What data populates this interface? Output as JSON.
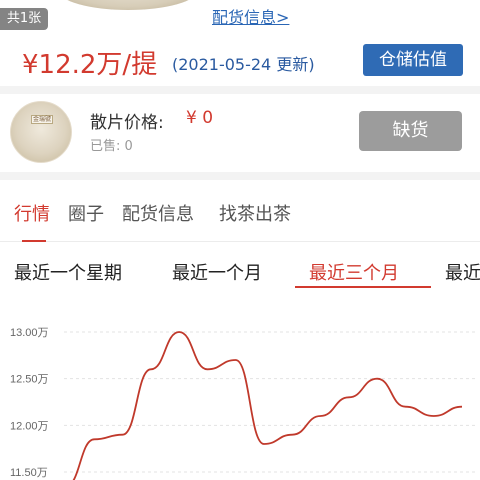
{
  "header": {
    "count_badge": "共1张",
    "peihuo_link": "配货信息>"
  },
  "price": {
    "main": "¥12.2万/提",
    "updated": "(2021-05-24 更新)",
    "storage_button": "仓储估值"
  },
  "product": {
    "thumb_text": "金瑞號",
    "sanpian_label": "散片价格:",
    "sanpian_value": "¥ 0",
    "sold_label": "已售: 0",
    "stock_button": "缺货"
  },
  "tabs": [
    {
      "label": "行情",
      "active": true
    },
    {
      "label": "圈子",
      "active": false
    },
    {
      "label": "配货信息",
      "active": false
    },
    {
      "label": "找茶出茶",
      "active": false
    }
  ],
  "periods": [
    {
      "label": "最近一个星期",
      "active": false
    },
    {
      "label": "最近一个月",
      "active": false
    },
    {
      "label": "最近三个月",
      "active": true
    },
    {
      "label": "最近",
      "active": false
    }
  ],
  "colors": {
    "accent_red": "#d23a2f",
    "link_blue": "#2a66b5",
    "button_blue": "#2f6bb5",
    "disabled_gray": "#9c9c9c"
  },
  "chart_data": {
    "type": "line",
    "y_ticks": [
      "13.00万",
      "12.50万",
      "12.00万",
      "11.50万"
    ],
    "y_tick_values": [
      13.0,
      12.5,
      12.0,
      11.5
    ],
    "ylim": [
      11.4,
      13.1
    ],
    "grid": true,
    "series": [
      {
        "values": [
          11.35,
          11.85,
          11.9,
          12.6,
          13.0,
          12.6,
          12.7,
          11.8,
          11.9,
          12.1,
          12.3,
          12.5,
          12.2,
          12.1,
          12.2
        ]
      }
    ]
  }
}
